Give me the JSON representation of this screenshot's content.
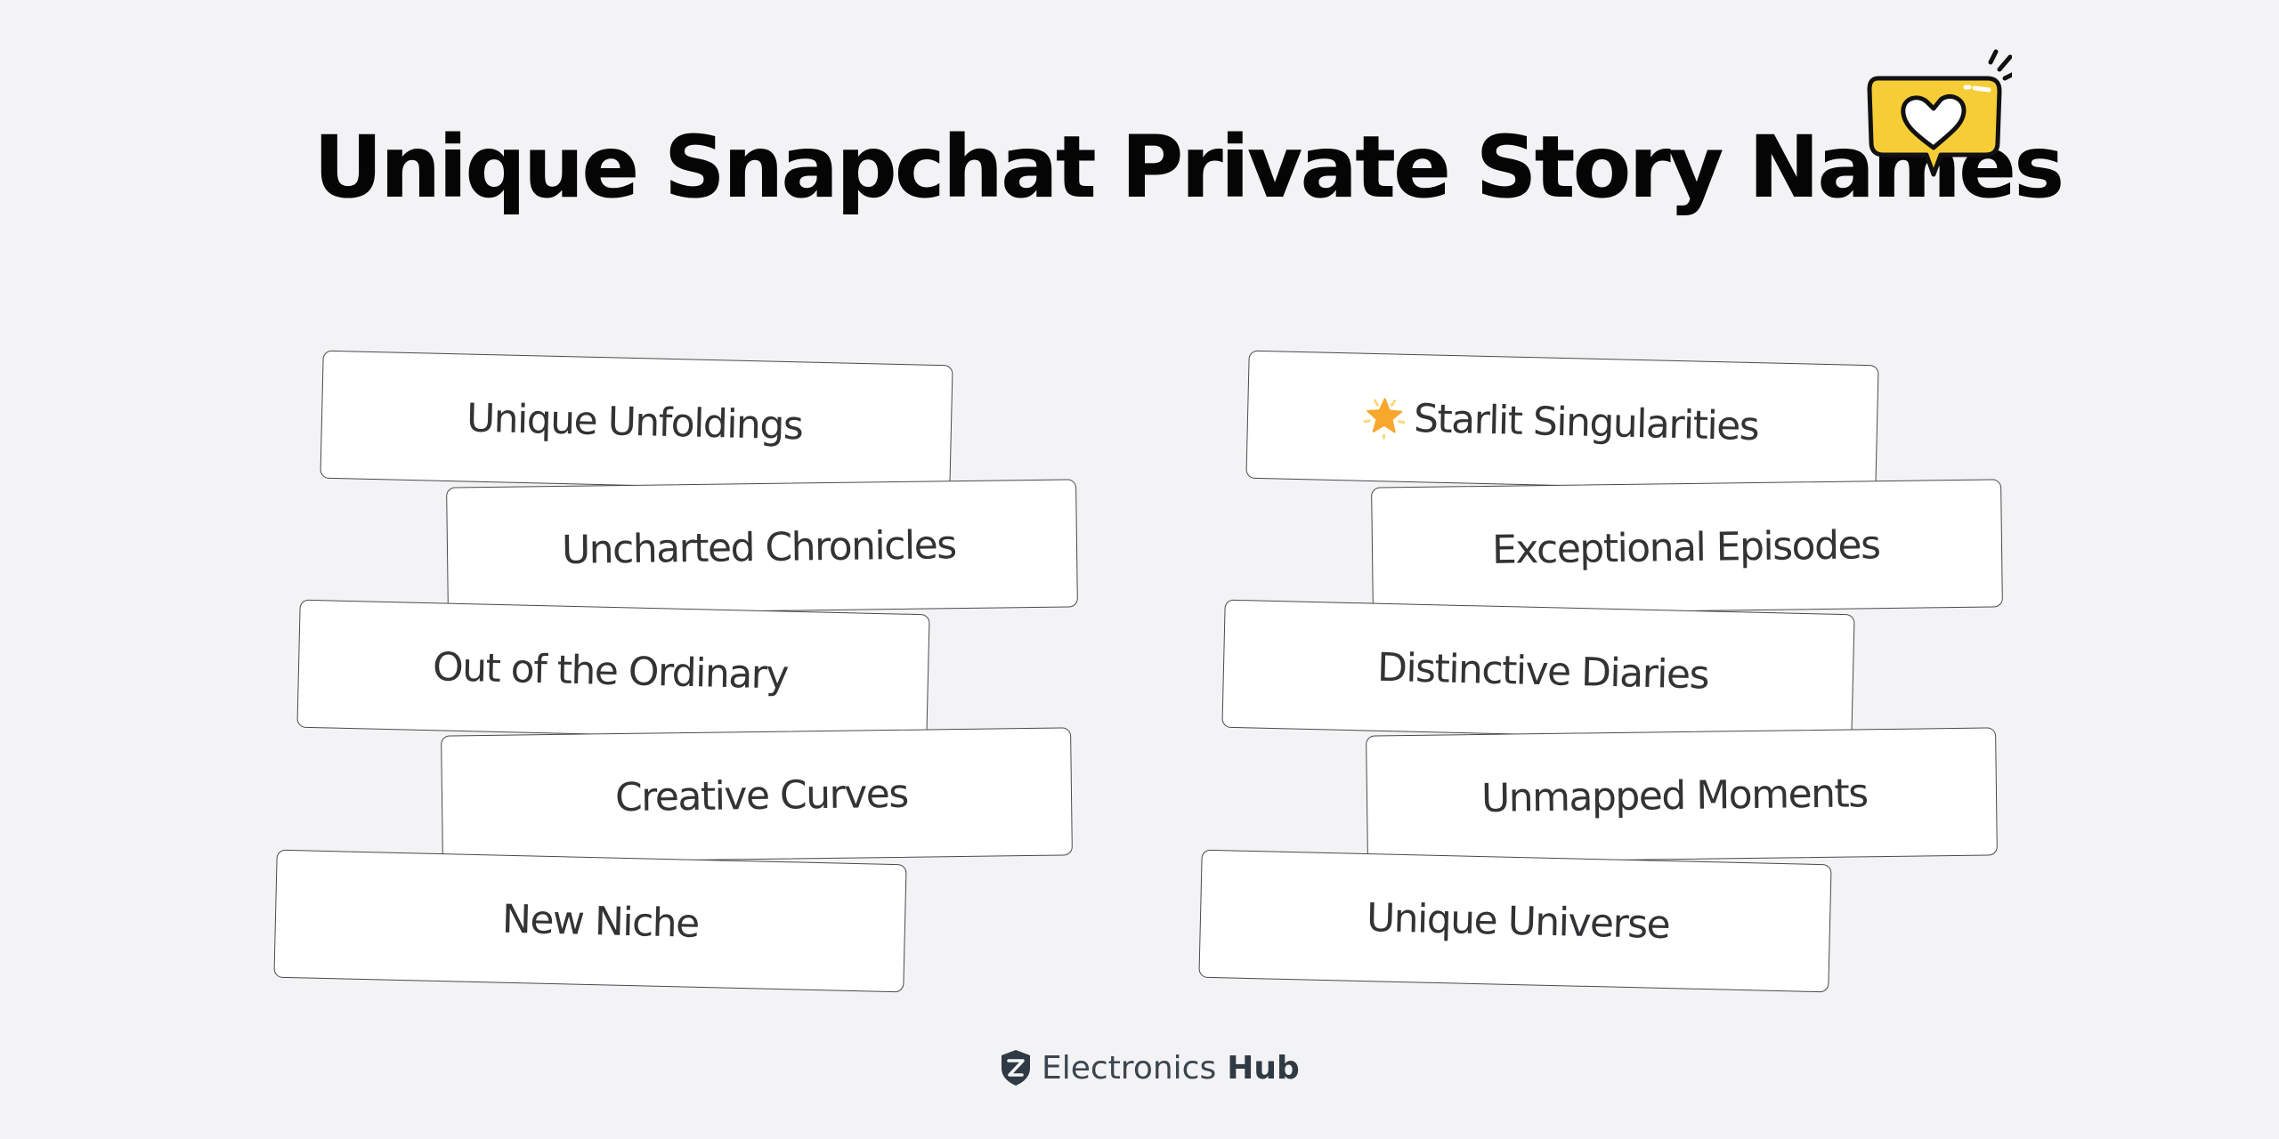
{
  "title": "Unique Snapchat Private Story Names",
  "icons": {
    "header": "heart-speech-bubble-icon",
    "star": "star-icon",
    "brand": "shield-logo-icon"
  },
  "colors": {
    "background": "#f3f3f5",
    "title": "#050505",
    "card_text": "#333336",
    "bubble_fill": "#f7cd37",
    "star_fill": "#f7a72c"
  },
  "columns": [
    {
      "names": [
        {
          "text": "Unique Unfoldings"
        },
        {
          "text": "Uncharted Chronicles"
        },
        {
          "text": "Out of the Ordinary"
        },
        {
          "text": "Creative Curves"
        },
        {
          "text": "New Niche"
        }
      ]
    },
    {
      "names": [
        {
          "text": "Starlit Singularities",
          "icon": "star-icon"
        },
        {
          "text": "Exceptional Episodes"
        },
        {
          "text": "Distinctive Diaries"
        },
        {
          "text": "Unmapped Moments"
        },
        {
          "text": "Unique Universe"
        }
      ]
    }
  ],
  "footer": {
    "brand_light": "Electronics",
    "brand_bold": "Hub"
  }
}
